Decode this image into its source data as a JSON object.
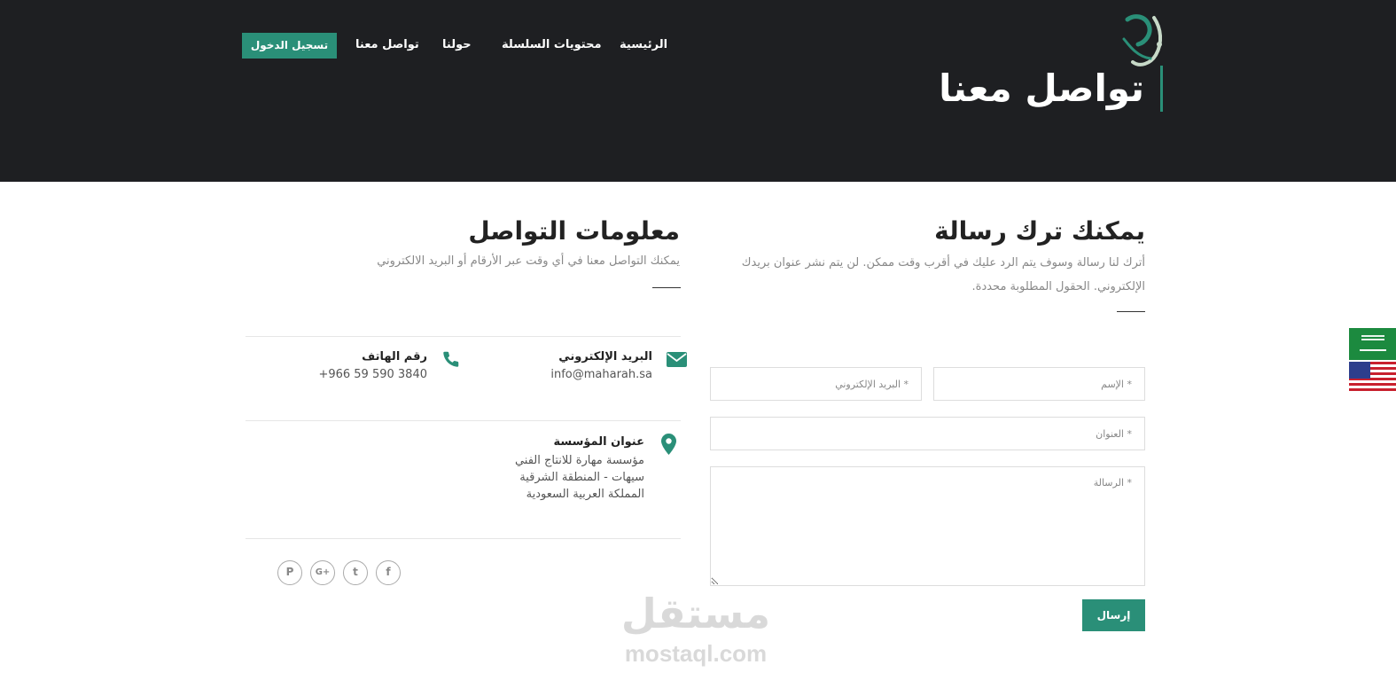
{
  "header": {
    "page_title": "تواصل معنا",
    "nav": {
      "home": "الرئيسية",
      "series_content": "محتويات السلسلة",
      "about": "حولنا",
      "contact": "تواصل معنا",
      "login": "تسجيل الدخول"
    }
  },
  "form": {
    "title": "يمكنك ترك رسالة",
    "description": "أترك لنا رسالة وسوف يتم الرد عليك في أقرب وقت ممكن. لن يتم نشر عنوان بريدك الإلكتروني. الحقول المطلوبة محددة.",
    "name_placeholder": "* الإسم",
    "email_placeholder": "* البريد الإلكتروني",
    "subject_placeholder": "* العنوان",
    "message_placeholder": "* الرسالة",
    "submit_label": "إرسال"
  },
  "contact_info": {
    "title": "معلومات التواصل",
    "description": "يمكنك التواصل معنا في أي وقت عبر الأرقام أو البريد الالكتروني",
    "email_label": "البريد الإلكتروني",
    "email_value": "info@maharah.sa",
    "phone_label": "رقم الهاتف",
    "phone_value": "+966 59 590 3840",
    "address_label": "عنوان المؤسسة",
    "address_lines": [
      "مؤسسة مهارة للانتاج الفني",
      "سيهات - المنطقة الشرقية",
      "المملكة العربية السعودية"
    ]
  },
  "social": {
    "facebook_glyph": "f",
    "twitter_glyph": "t",
    "google_glyph": "G+",
    "pinterest_glyph": "P"
  },
  "watermark": {
    "arabic": "مستقل",
    "latin": "mostaql.com"
  },
  "colors": {
    "accent": "#2a8f78",
    "header_bg": "#1e1f22"
  }
}
